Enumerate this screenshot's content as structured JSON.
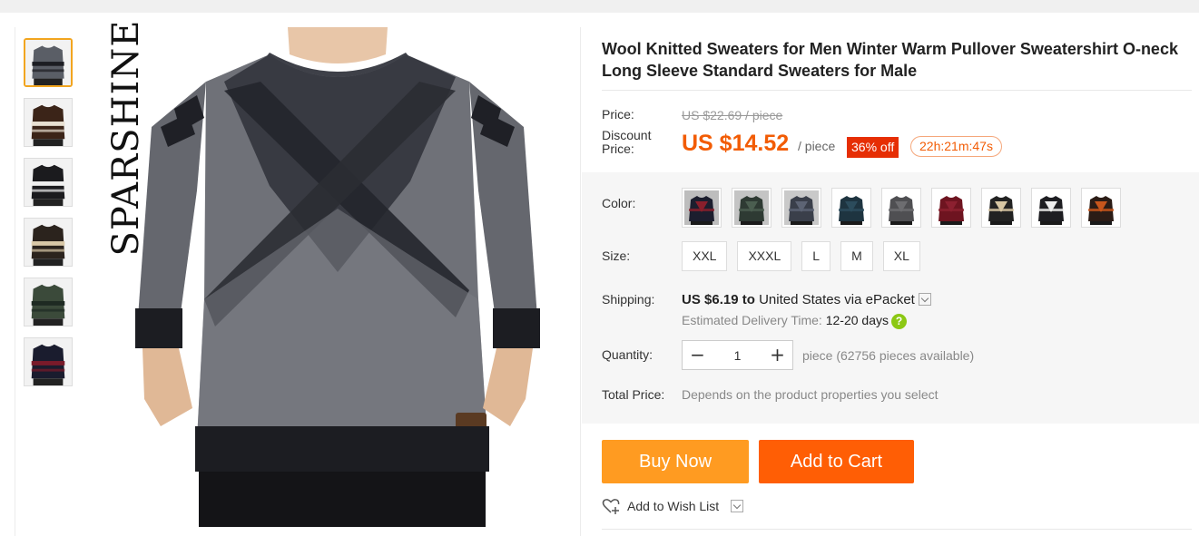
{
  "product": {
    "title": "Wool Knitted Sweaters for Men Winter Warm Pullover Sweatershirt O-neck Long Sleeve Standard Sweaters for Male",
    "brand_watermark": "SPARSHINE",
    "main_image_icon": "gray-sweater-image",
    "thumbnails": [
      {
        "name": "gray-black-sweater-thumb",
        "colors": [
          "#5a5e66",
          "#1c1d22"
        ]
      },
      {
        "name": "brown-stripe-sweater-thumb",
        "colors": [
          "#3b2418",
          "#e8e0d2"
        ]
      },
      {
        "name": "black-white-stripe-sweater-thumb",
        "colors": [
          "#1b1b1e",
          "#efefef"
        ]
      },
      {
        "name": "beige-stripe-sweater-thumb",
        "colors": [
          "#2b231d",
          "#d9c8a8"
        ]
      },
      {
        "name": "green-sweater-thumb",
        "colors": [
          "#3b4a3a",
          "#1e2a22"
        ]
      },
      {
        "name": "navy-red-sweater-thumb",
        "colors": [
          "#1a1c2e",
          "#7a1a2a"
        ]
      }
    ]
  },
  "pricing": {
    "price_label": "Price:",
    "original_price": "US $22.69 / piece",
    "discount_label": "Discount Price:",
    "discount_price": "US $14.52",
    "per_piece": "/ piece",
    "off_badge": "36% off",
    "countdown": "22h:21m:47s"
  },
  "options": {
    "color_label": "Color:",
    "color_swatches": [
      {
        "name": "navy-red",
        "body": "#1c1e2e",
        "accent": "#8a1f2c",
        "bg": "#bdbdbd"
      },
      {
        "name": "dark-green",
        "body": "#2e3a33",
        "accent": "#4b5e50",
        "bg": "#c4c4c4"
      },
      {
        "name": "dark-gray",
        "body": "#3a3f4a",
        "accent": "#5d6474",
        "bg": "#c9c9c9"
      },
      {
        "name": "teal-navy",
        "body": "#1e3440",
        "accent": "#2c4c5c",
        "bg": "#ffffff"
      },
      {
        "name": "gray",
        "body": "#4f4f52",
        "accent": "#6d6d70",
        "bg": "#ffffff"
      },
      {
        "name": "burgundy",
        "body": "#6e1420",
        "accent": "#8c2030",
        "bg": "#ffffff"
      },
      {
        "name": "black-beige-stripe",
        "body": "#222",
        "accent": "#d8c7a4",
        "bg": "#ffffff"
      },
      {
        "name": "black-white-stripe",
        "body": "#1e1e22",
        "accent": "#eeeeee",
        "bg": "#ffffff"
      },
      {
        "name": "brown-orange-stripe",
        "body": "#2b1c16",
        "accent": "#c8561c",
        "bg": "#ffffff"
      }
    ],
    "size_label": "Size:",
    "sizes": [
      "XXL",
      "XXXL",
      "L",
      "M",
      "XL"
    ]
  },
  "shipping": {
    "label": "Shipping:",
    "cost": "US $6.19",
    "to_word": "to",
    "destination": "United States via ePacket",
    "delivery_label": "Estimated Delivery Time:",
    "delivery_days": "12-20",
    "days_word": "days",
    "help_icon": "?"
  },
  "quantity": {
    "label": "Quantity:",
    "minus": "−",
    "value": "1",
    "plus": "+",
    "availability": "piece (62756 pieces available)"
  },
  "total": {
    "label": "Total Price:",
    "value": "Depends on the product properties you select"
  },
  "actions": {
    "buy_now": "Buy Now",
    "add_to_cart": "Add to Cart",
    "wish_list": "Add to Wish List"
  },
  "colors": {
    "accent_orange": "#ff5e05",
    "buy_orange": "#ff9b21",
    "price_orange": "#f25c05",
    "badge_red": "#e62e04",
    "thumb_active_border": "#f2a51f"
  }
}
